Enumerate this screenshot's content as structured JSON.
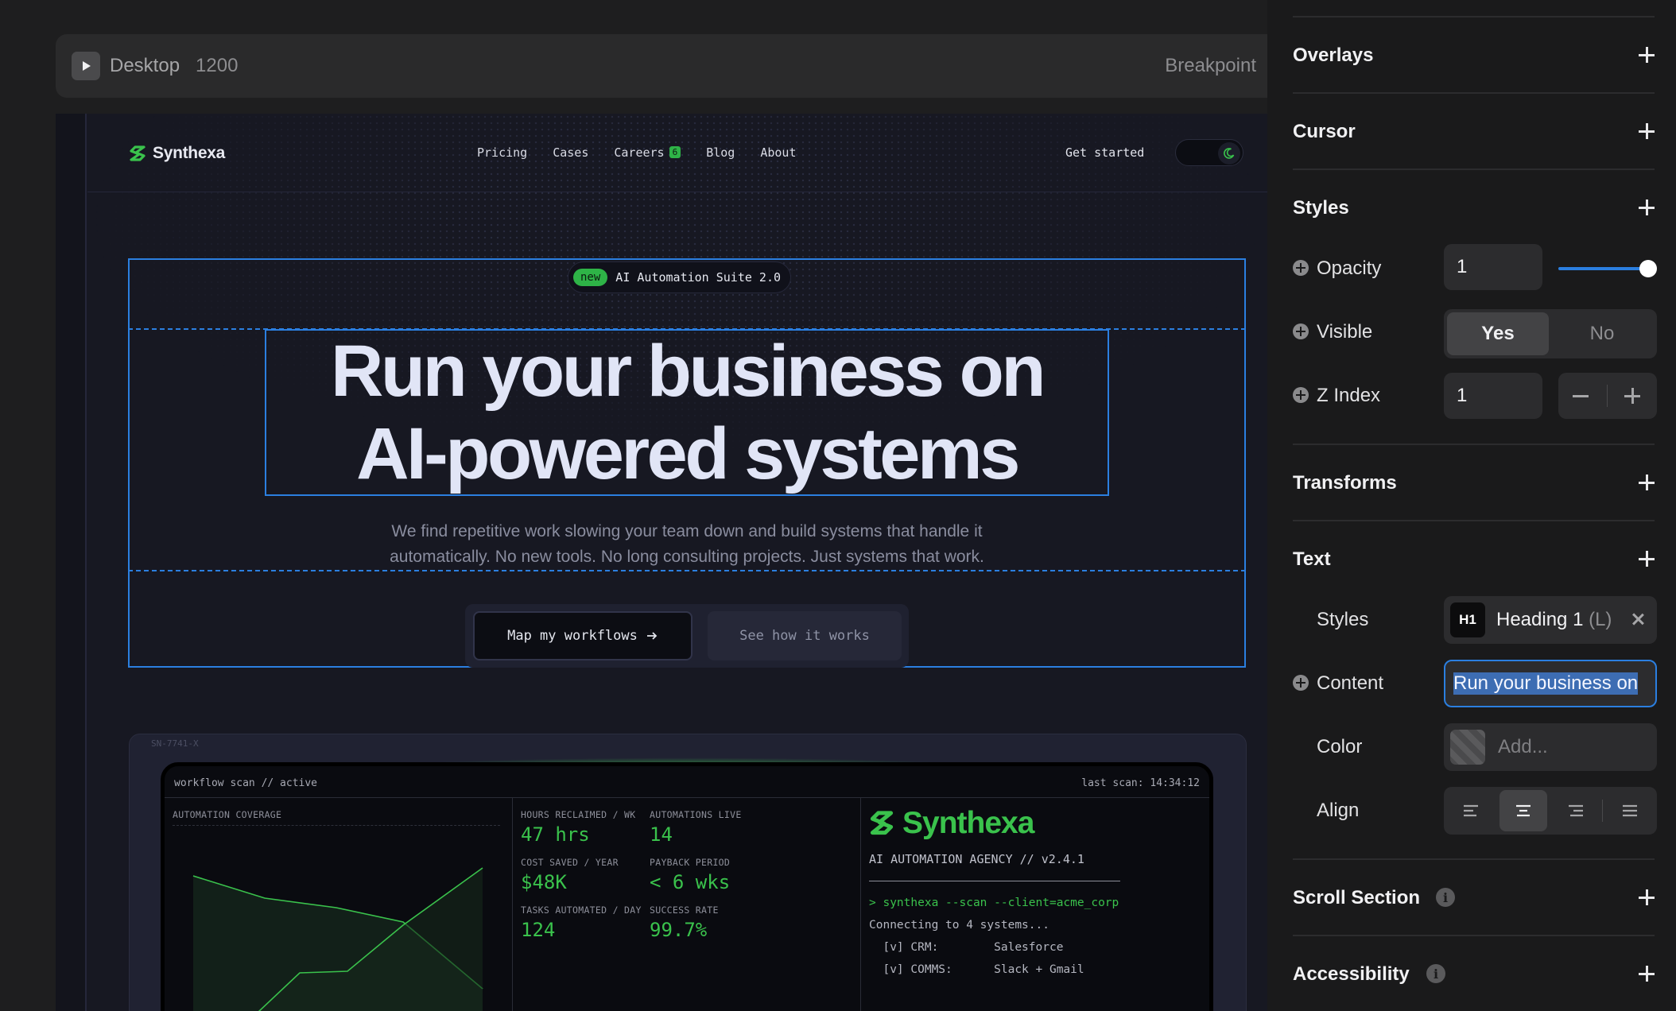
{
  "breakpoint": {
    "device": "Desktop",
    "width": "1200",
    "label": "Breakpoint"
  },
  "site": {
    "logo": "Synthexa",
    "nav": [
      {
        "label": "Pricing"
      },
      {
        "label": "Cases"
      },
      {
        "label": "Careers",
        "badge": "6"
      },
      {
        "label": "Blog"
      },
      {
        "label": "About"
      }
    ],
    "cta": "Get started",
    "pill_badge": "new",
    "pill_text": "AI Automation Suite 2.0",
    "hero_line1": "Run your business on",
    "hero_line2": "AI-powered systems",
    "sub_line1": "We find repetitive work slowing your team down and build systems that handle it",
    "sub_line2": "automatically. No new tools. No long consulting projects. Just systems that work.",
    "btn_primary": "Map my workflows",
    "btn_secondary": "See how it works",
    "device_serial": "SN-7741-X",
    "screen": {
      "title": "workflow scan // active",
      "last_scan": "last scan: 14:34:12",
      "coverage_label": "AUTOMATION COVERAGE",
      "stats": [
        {
          "label": "HOURS RECLAIMED / WK",
          "value": "47 hrs"
        },
        {
          "label": "AUTOMATIONS LIVE",
          "value": "14"
        },
        {
          "label": "COST SAVED / YEAR",
          "value": "$48K"
        },
        {
          "label": "PAYBACK PERIOD",
          "value": "< 6 wks"
        },
        {
          "label": "TASKS AUTOMATED / DAY",
          "value": "124"
        },
        {
          "label": "SUCCESS RATE",
          "value": "99.7%"
        }
      ],
      "brand": "Synthexa",
      "agency": "AI AUTOMATION AGENCY  //  v2.4.1",
      "terminal": [
        "> synthexa --scan --client=acme_corp",
        "Connecting to 4 systems...",
        "  [v] CRM:        Salesforce",
        "  [v] COMMS:      Slack + Gmail"
      ]
    }
  },
  "panel": {
    "overlays": "Overlays",
    "cursor": "Cursor",
    "styles": "Styles",
    "opacity_label": "Opacity",
    "opacity_value": "1",
    "visible_label": "Visible",
    "visible_yes": "Yes",
    "visible_no": "No",
    "zindex_label": "Z Index",
    "zindex_value": "1",
    "transforms": "Transforms",
    "text": "Text",
    "text_styles_label": "Styles",
    "text_style_tag": "H1",
    "text_style_name": "Heading 1",
    "text_style_size": "(L)",
    "content_label": "Content",
    "content_value": "Run your business on",
    "color_label": "Color",
    "color_placeholder": "Add...",
    "align_label": "Align",
    "scroll_section": "Scroll Section",
    "accessibility": "Accessibility",
    "opacity_level": 1
  }
}
